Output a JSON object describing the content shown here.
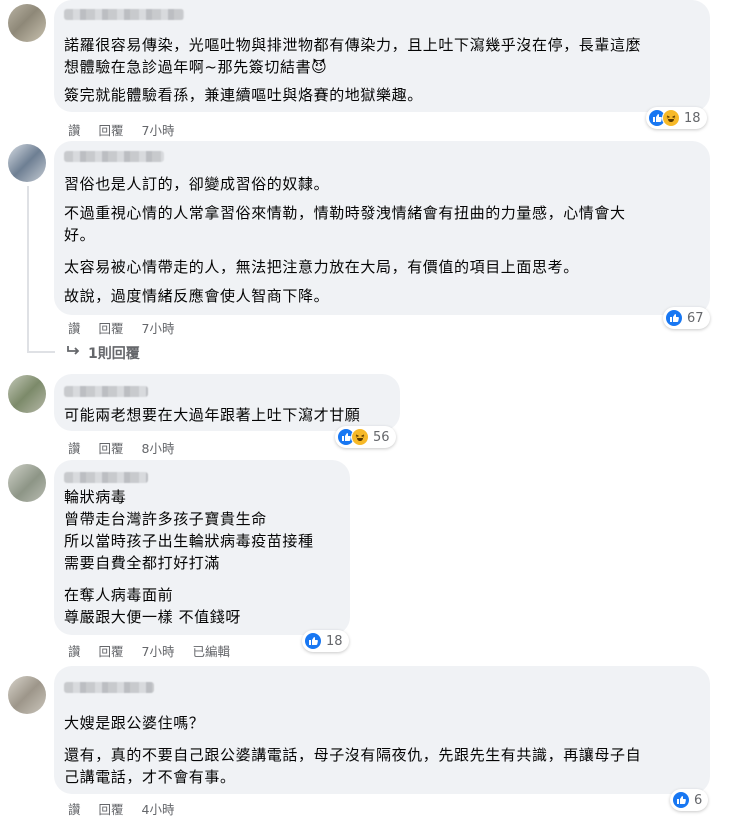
{
  "colors": {
    "bubble": "#f0f2f5",
    "like_blue": "#1877f2",
    "haha_yellow": "#f7b928",
    "meta_text": "#65676b"
  },
  "comments": [
    {
      "paragraphs": [
        "諾羅很容易傳染，光嘔吐物與排泄物都有傳染力，且上吐下瀉幾乎沒在停，長輩這麼\n想體驗在急診過年啊~那先簽切結書😈",
        "簽完就能體驗看孫，兼連續嘔吐與烙賽的地獄樂趣。"
      ],
      "actions": [
        "讚",
        "回覆",
        "7小時"
      ],
      "reaction_icons": [
        "like-icon",
        "haha-icon"
      ],
      "reaction_count": "18"
    },
    {
      "paragraphs": [
        "習俗也是人訂的，卻變成習俗的奴隸。",
        "不過重視心情的人常拿習俗來情勒，情勒時發洩情緒會有扭曲的力量感，心情會大\n好。",
        "太容易被心情帶走的人，無法把注意力放在大局，有價值的項目上面思考。",
        "故說，過度情緒反應會使人智商下降。"
      ],
      "actions": [
        "讚",
        "回覆",
        "7小時"
      ],
      "reaction_icons": [
        "like-icon"
      ],
      "reaction_count": "67",
      "replies_label": "1則回覆"
    },
    {
      "paragraphs": [
        "可能兩老想要在大過年跟著上吐下瀉才甘願"
      ],
      "actions": [
        "讚",
        "回覆",
        "8小時"
      ],
      "reaction_icons": [
        "like-icon",
        "haha-icon"
      ],
      "reaction_count": "56"
    },
    {
      "paragraphs": [
        "輪狀病毒\n曾帶走台灣許多孩子寶貴生命\n所以當時孩子出生輪狀病毒疫苗接種\n需要自費全都打好打滿",
        "在奪人病毒面前\n尊嚴跟大便一樣 不值錢呀"
      ],
      "actions": [
        "讚",
        "回覆",
        "7小時",
        "已編輯"
      ],
      "reaction_icons": [
        "like-icon"
      ],
      "reaction_count": "18"
    },
    {
      "paragraphs": [
        "大嫂是跟公婆住嗎？",
        "還有，真的不要自己跟公婆講電話，母子沒有隔夜仇，先跟先生有共識，再讓母子自\n己講電話，才不會有事。"
      ],
      "actions": [
        "讚",
        "回覆",
        "4小時"
      ],
      "reaction_icons": [
        "like-icon"
      ],
      "reaction_count": "6"
    }
  ]
}
